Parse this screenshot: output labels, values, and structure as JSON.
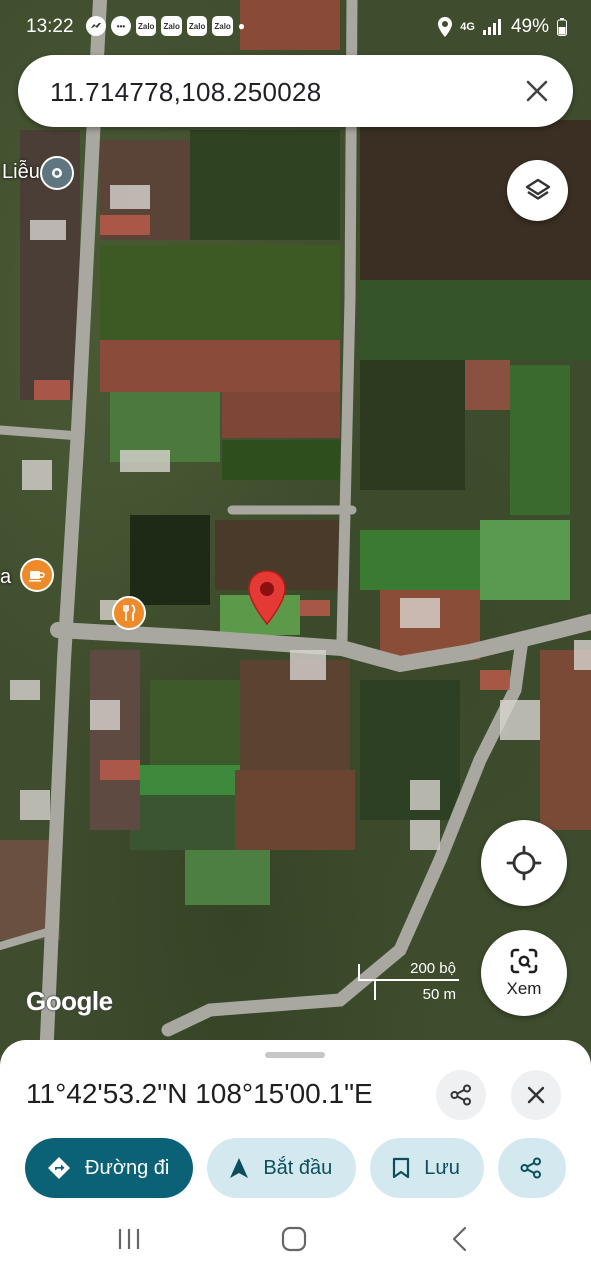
{
  "status_bar": {
    "time": "13:22",
    "apps": [
      "Zalo",
      "Zalo",
      "Zalo",
      "Zalo"
    ],
    "network": "4G",
    "battery": "49%"
  },
  "search": {
    "query": "11.714778,108.250028"
  },
  "map": {
    "place_label_1": "Liễu",
    "place_label_2": "a",
    "scale_imperial": "200 bộ",
    "scale_metric": "50 m",
    "attribution": "Google",
    "view_button_label": "Xem"
  },
  "sheet": {
    "coordinates": "11°42'53.2\"N 108°15'00.1\"E",
    "actions": {
      "directions": "Đường đi",
      "start": "Bắt đầu",
      "save": "Lưu"
    }
  },
  "colors": {
    "primary": "#0b6175",
    "chip_bg": "#d3e9ef",
    "pin": "#e53935"
  }
}
